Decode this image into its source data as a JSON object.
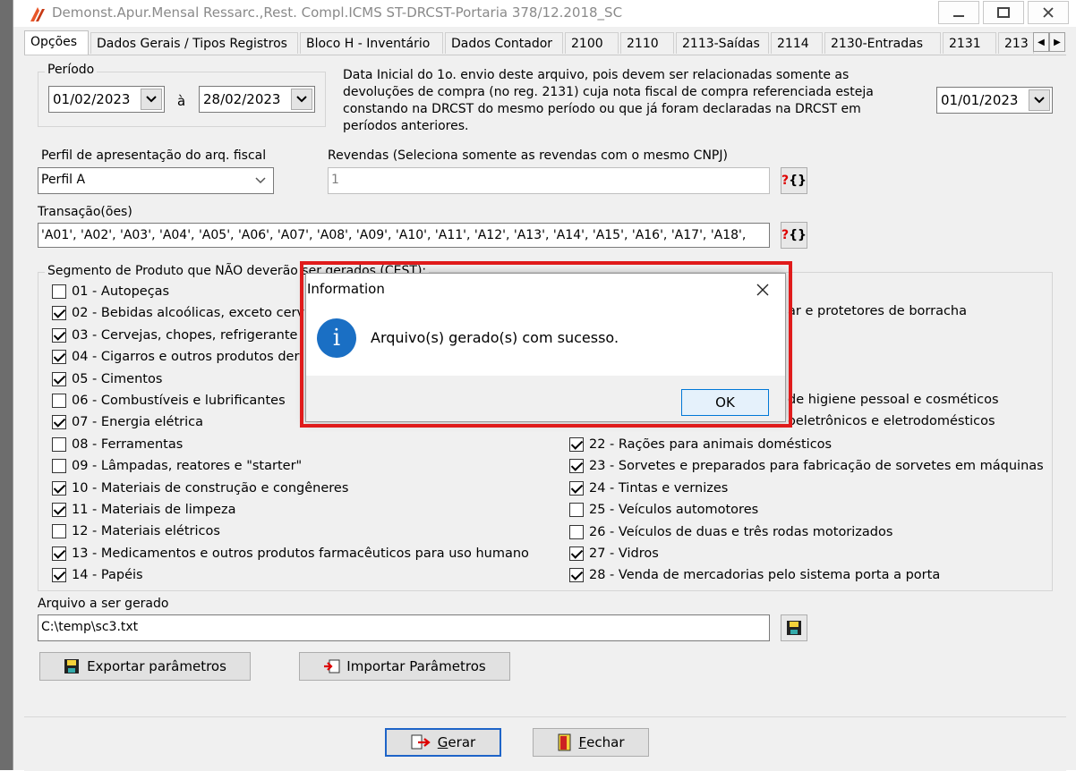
{
  "window": {
    "title": "Demonst.Apur.Mensal Ressarc.,Rest. Compl.ICMS ST-DRCST-Portaria 378/12.2018_SC",
    "minimize_icon": "minimize-icon",
    "maximize_icon": "maximize-icon",
    "close_icon": "close-icon"
  },
  "tabs": [
    "Opções",
    "Dados Gerais / Tipos Registros",
    "Bloco H - Inventário",
    "Dados Contador",
    "2100",
    "2110",
    "2113-Saídas",
    "2114",
    "2130-Entradas",
    "2131",
    "213"
  ],
  "periodo": {
    "label": "Período",
    "from": "01/02/2023",
    "sep": "à",
    "to": "28/02/2023",
    "note": [
      "Data Inicial do 1o. envio deste arquivo, pois devem ser relacionadas somente as",
      "devoluções de compra (no reg. 2131) cuja nota fiscal de compra referenciada esteja",
      "constando na DRCST do mesmo período ou que já foram declaradas na DRCST em",
      "períodos anteriores."
    ],
    "initial_date": "01/01/2023"
  },
  "perfil": {
    "label": "Perfil de apresentação do arq. fiscal",
    "value": "Perfil A"
  },
  "revendas": {
    "label": "Revendas (Seleciona somente as revendas com o mesmo CNPJ)",
    "value": "1",
    "button": "?{}"
  },
  "transacoes": {
    "label": "Transação(ões)",
    "value": "'A01', 'A02', 'A03', 'A04', 'A05', 'A06', 'A07', 'A08', 'A09', 'A10', 'A11', 'A12', 'A13', 'A14', 'A15', 'A16', 'A17', 'A18',",
    "button": "?{}"
  },
  "segmento": {
    "label": "Segmento de Produto que NÃO deverão ser gerados (CEST):",
    "left": [
      {
        "label": "01 - Autopeças",
        "checked": false
      },
      {
        "label": "02 - Bebidas alcoólicas, exceto cerv",
        "checked": true
      },
      {
        "label": "03 - Cervejas, chopes, refrigerante",
        "checked": true
      },
      {
        "label": "04 - Cigarros e outros produtos der",
        "checked": true
      },
      {
        "label": "05 - Cimentos",
        "checked": true
      },
      {
        "label": "06 - Combustíveis e lubrificantes",
        "checked": false
      },
      {
        "label": "07 - Energia elétrica",
        "checked": true
      },
      {
        "label": "08 - Ferramentas",
        "checked": false
      },
      {
        "label": "09 - Lâmpadas, reatores e \"starter\"",
        "checked": false
      },
      {
        "label": "10 - Materiais de construção e congêneres",
        "checked": true
      },
      {
        "label": "11 - Materiais de limpeza",
        "checked": true
      },
      {
        "label": "12 - Materiais elétricos",
        "checked": false
      },
      {
        "label": "13 - Medicamentos e outros produtos farmacêuticos para uso humano",
        "checked": true
      },
      {
        "label": "14 - Papéis",
        "checked": true
      }
    ],
    "right_partial": [
      "ar e protetores de borracha",
      "de higiene pessoal e cosméticos",
      "oeletrônicos e eletrodomésticos"
    ],
    "right": [
      {
        "label": "22 - Rações para animais domésticos",
        "checked": true
      },
      {
        "label": "23 - Sorvetes e preparados para fabricação de sorvetes em máquinas",
        "checked": true
      },
      {
        "label": "24 - Tintas e vernizes",
        "checked": true
      },
      {
        "label": "25 - Veículos automotores",
        "checked": false
      },
      {
        "label": "26 - Veículos de duas e três rodas motorizados",
        "checked": false
      },
      {
        "label": "27 - Vidros",
        "checked": true
      },
      {
        "label": "28 - Venda de mercadorias pelo sistema porta a porta",
        "checked": true
      }
    ]
  },
  "arquivo": {
    "label": "Arquivo a ser gerado",
    "value": "C:\\temp\\sc3.txt"
  },
  "buttons": {
    "exportar": "Exportar parâmetros",
    "importar": "Importar Parâmetros",
    "gerar_u": "G",
    "gerar_rest": "erar",
    "fechar_u": "F",
    "fechar_rest": "echar"
  },
  "dialog": {
    "title": "Information",
    "message": "Arquivo(s) gerado(s) com sucesso.",
    "ok": "OK",
    "info_icon": "i"
  },
  "colors": {
    "highlight": "#e01b1b",
    "info_blue": "#1a6fc4",
    "default_button": "#1e64c8"
  }
}
